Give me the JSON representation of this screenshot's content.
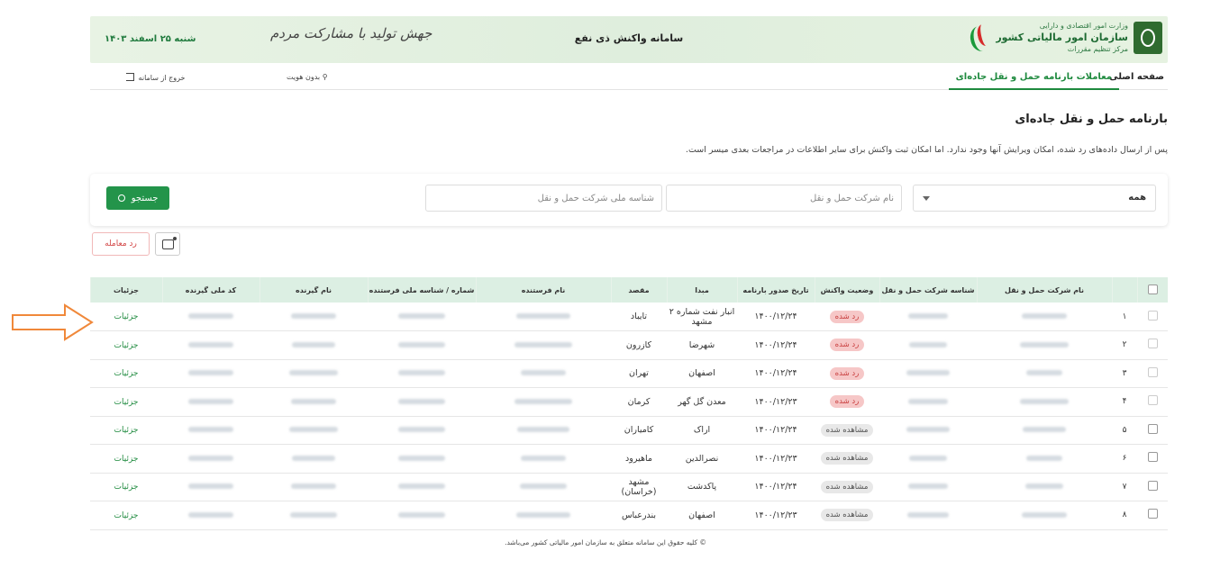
{
  "header": {
    "ministry": "وزارت امور اقتصادی و دارایی",
    "org": "سازمان امور مالیاتی کشور",
    "center": "مرکز تنظیم مقررات",
    "title": "سامانه واکنش ذی نفع",
    "slogan": "جهش تولید با مشارکت مردم",
    "date": "شنبه ۲۵ اسفند ۱۴۰۳"
  },
  "nav": {
    "home": "صفحه اصلی",
    "active": "معاملات بارنامه حمل و نقل جاده‌ای",
    "user": "بدون هویت",
    "logout": "خروج از سامانه"
  },
  "page": {
    "title": "بارنامه حمل و نقل جاده‌ای",
    "notice": "پس از ارسال داده‌های رد شده، امکان ویرایش آنها وجود ندارد. اما امکان ثبت واکنش برای سایر اطلاعات در مراجعات بعدی میسر است."
  },
  "filter": {
    "select_value": "همه",
    "company_placeholder": "نام شرکت حمل و نقل",
    "national_placeholder": "شناسه ملی شرکت حمل و نقل",
    "search_label": "جستجو"
  },
  "actions": {
    "reject_label": "رد معامله"
  },
  "table": {
    "headers": {
      "company": "نام شرکت حمل و نقل",
      "company_id": "شناسه شرکت حمل و نقل",
      "status": "وضعیت واکنش",
      "issue_date": "تاریخ صدور بارنامه",
      "origin": "مبدا",
      "destination": "مقصد",
      "sender": "نام فرستنده",
      "sender_id": "شماره / شناسه ملی فرستنده",
      "receiver": "نام گیرنده",
      "receiver_code": "کد ملی گیرنده",
      "details": "جزئیات"
    },
    "rows": [
      {
        "idx": "۱",
        "status": "رد شده",
        "status_type": "rejected",
        "date": "۱۴۰۰/۱۲/۲۴",
        "origin": "انبار نفت شماره ۲ مشهد",
        "dest": "تایباد",
        "details": "جزئیات"
      },
      {
        "idx": "۲",
        "status": "رد شده",
        "status_type": "rejected",
        "date": "۱۴۰۰/۱۲/۲۴",
        "origin": "شهرضا",
        "dest": "کازرون",
        "details": "جزئیات"
      },
      {
        "idx": "۳",
        "status": "رد شده",
        "status_type": "rejected",
        "date": "۱۴۰۰/۱۲/۲۴",
        "origin": "اصفهان",
        "dest": "تهران",
        "details": "جزئیات"
      },
      {
        "idx": "۴",
        "status": "رد شده",
        "status_type": "rejected",
        "date": "۱۴۰۰/۱۲/۲۳",
        "origin": "معدن گل گهر",
        "dest": "کرمان",
        "details": "جزئیات"
      },
      {
        "idx": "۵",
        "status": "مشاهده شده",
        "status_type": "seen",
        "date": "۱۴۰۰/۱۲/۲۴",
        "origin": "اراک",
        "dest": "کامیاران",
        "details": "جزئیات"
      },
      {
        "idx": "۶",
        "status": "مشاهده شده",
        "status_type": "seen",
        "date": "۱۴۰۰/۱۲/۲۳",
        "origin": "نصرالدین",
        "dest": "ماهیرود",
        "details": "جزئیات"
      },
      {
        "idx": "۷",
        "status": "مشاهده شده",
        "status_type": "seen",
        "date": "۱۴۰۰/۱۲/۲۴",
        "origin": "پاکدشت",
        "dest": "مشهد (خراسان)",
        "details": "جزئیات"
      },
      {
        "idx": "۸",
        "status": "مشاهده شده",
        "status_type": "seen",
        "date": "۱۴۰۰/۱۲/۲۳",
        "origin": "اصفهان",
        "dest": "بندرعباس",
        "details": "جزئیات"
      }
    ]
  },
  "footer": "© کلیه حقوق این سامانه متعلق به سازمان امور مالیاتی کشور می‌باشد.",
  "colors": {
    "accent": "#23944a",
    "header_bg": "#e3f0df",
    "rejected_bg": "#f6c7c7",
    "arrow": "#f0883a"
  }
}
